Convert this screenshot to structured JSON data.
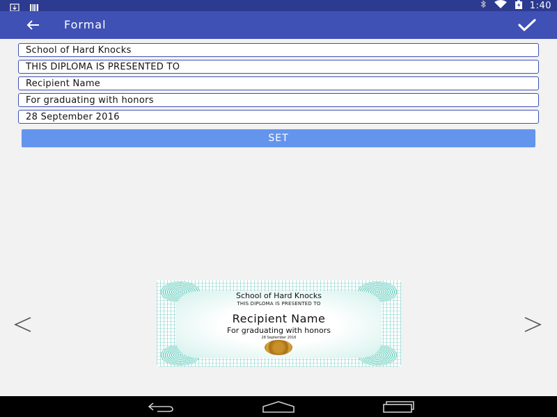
{
  "status_bar": {
    "time": "1:40",
    "icons": [
      "download-icon",
      "barcode-icon",
      "bluetooth-icon",
      "wifi-icon",
      "battery-charging-icon"
    ]
  },
  "app_bar": {
    "title": "Formal",
    "back_icon": "arrow-left-icon",
    "confirm_icon": "check-icon"
  },
  "form": {
    "fields": [
      {
        "value": "School of Hard Knocks"
      },
      {
        "value": "THIS DIPLOMA IS PRESENTED TO"
      },
      {
        "value": "Recipient Name"
      },
      {
        "value": "For graduating with honors"
      },
      {
        "value": "28 September 2016"
      }
    ],
    "set_label": "SET"
  },
  "certificate": {
    "school": "School of Hard Knocks",
    "presented": "THIS DIPLOMA IS PRESENTED TO",
    "recipient": "Recipient Name",
    "honors": "For graduating with honors",
    "date": "28 September 2016"
  },
  "carousel": {
    "prev_icon": "chevron-left-icon",
    "next_icon": "chevron-right-icon"
  },
  "nav_bar": {
    "icons": [
      "back-icon",
      "home-icon",
      "recents-icon"
    ]
  },
  "colors": {
    "status_bar": "#2c3a8f",
    "app_bar": "#3f51b5",
    "set_button": "#6495ed",
    "field_border": "#3f51b5"
  }
}
